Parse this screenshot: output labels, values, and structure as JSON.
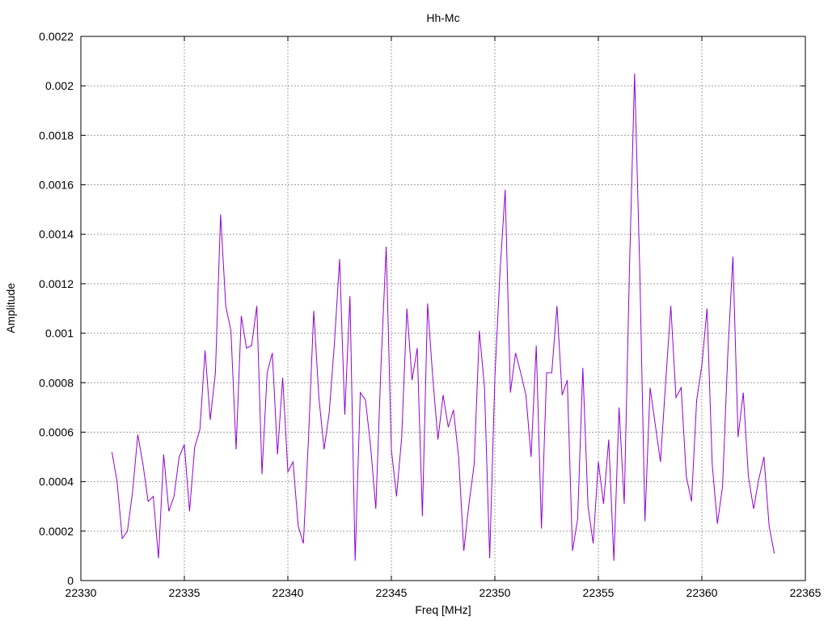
{
  "chart_data": {
    "type": "line",
    "title": "Hh-Mc",
    "xlabel": "Freq [MHz]",
    "ylabel": "Amplitude",
    "xlim": [
      22330,
      22365
    ],
    "ylim": [
      0,
      0.0022
    ],
    "grid": true,
    "x_ticks": [
      22330,
      22335,
      22340,
      22345,
      22350,
      22355,
      22360,
      22365
    ],
    "x_tick_labels": [
      "22330",
      "22335",
      "22340",
      "22345",
      "22350",
      "22355",
      "22360",
      "22365"
    ],
    "y_ticks": [
      0,
      0.0002,
      0.0004,
      0.0006,
      0.0008,
      0.001,
      0.0012,
      0.0014,
      0.0016,
      0.0018,
      0.002,
      0.0022
    ],
    "y_tick_labels": [
      "0",
      "0.0002",
      "0.0004",
      "0.0006",
      "0.0008",
      "0.001",
      "0.0012",
      "0.0014",
      "0.0016",
      "0.0018",
      "0.002",
      "0.0022"
    ],
    "series": [
      {
        "color": "#9400d3",
        "x": [
          22331.5,
          22331.75,
          22332,
          22332.25,
          22332.5,
          22332.75,
          22333,
          22333.25,
          22333.5,
          22333.75,
          22334,
          22334.25,
          22334.5,
          22334.75,
          22335,
          22335.25,
          22335.5,
          22335.75,
          22336,
          22336.25,
          22336.5,
          22336.75,
          22337,
          22337.25,
          22337.5,
          22337.75,
          22338,
          22338.25,
          22338.5,
          22338.75,
          22339,
          22339.25,
          22339.5,
          22339.75,
          22340,
          22340.25,
          22340.5,
          22340.75,
          22341,
          22341.25,
          22341.5,
          22341.75,
          22342,
          22342.25,
          22342.5,
          22342.75,
          22343,
          22343.25,
          22343.5,
          22343.75,
          22344,
          22344.25,
          22344.5,
          22344.75,
          22345,
          22345.25,
          22345.5,
          22345.75,
          22346,
          22346.25,
          22346.5,
          22346.75,
          22347,
          22347.25,
          22347.5,
          22347.75,
          22348,
          22348.25,
          22348.5,
          22348.75,
          22349,
          22349.25,
          22349.5,
          22349.75,
          22350,
          22350.25,
          22350.5,
          22350.75,
          22351,
          22351.25,
          22351.5,
          22351.75,
          22352,
          22352.25,
          22352.5,
          22352.75,
          22353,
          22353.25,
          22353.5,
          22353.75,
          22354,
          22354.25,
          22354.5,
          22354.75,
          22355,
          22355.25,
          22355.5,
          22355.75,
          22356,
          22356.25,
          22356.5,
          22356.75,
          22357,
          22357.25,
          22357.5,
          22357.75,
          22358,
          22358.25,
          22358.5,
          22358.75,
          22359,
          22359.25,
          22359.5,
          22359.75,
          22360,
          22360.25,
          22360.5,
          22360.75,
          22361,
          22361.25,
          22361.5,
          22361.75,
          22362,
          22362.25,
          22362.5,
          22362.75,
          22363,
          22363.25,
          22363.5
        ],
        "y": [
          0.00052,
          0.0004,
          0.00017,
          0.0002,
          0.00036,
          0.00059,
          0.00047,
          0.00032,
          0.00034,
          9e-05,
          0.00051,
          0.00028,
          0.00034,
          0.0005,
          0.00055,
          0.00028,
          0.00054,
          0.00061,
          0.00093,
          0.00065,
          0.00084,
          0.00148,
          0.00111,
          0.00101,
          0.00053,
          0.00107,
          0.00094,
          0.00095,
          0.00111,
          0.00043,
          0.00084,
          0.00092,
          0.00051,
          0.00082,
          0.00044,
          0.00048,
          0.00022,
          0.00015,
          0.00058,
          0.00109,
          0.00074,
          0.00053,
          0.00068,
          0.00096,
          0.0013,
          0.00067,
          0.00115,
          8e-05,
          0.00076,
          0.00073,
          0.00054,
          0.00029,
          0.00087,
          0.00135,
          0.00053,
          0.00034,
          0.00058,
          0.0011,
          0.00081,
          0.00094,
          0.00026,
          0.00112,
          0.00082,
          0.00057,
          0.00075,
          0.00062,
          0.00069,
          0.0005,
          0.00012,
          0.00031,
          0.00047,
          0.00101,
          0.00078,
          9e-05,
          0.00082,
          0.00125,
          0.00158,
          0.00076,
          0.00092,
          0.00084,
          0.00075,
          0.0005,
          0.00095,
          0.00021,
          0.00084,
          0.00084,
          0.00111,
          0.00075,
          0.00081,
          0.00012,
          0.00025,
          0.00086,
          0.0003,
          0.00015,
          0.00048,
          0.00031,
          0.00057,
          8e-05,
          0.0007,
          0.00031,
          0.00125,
          0.00205,
          0.00126,
          0.00024,
          0.00078,
          0.00063,
          0.00048,
          0.0008,
          0.00111,
          0.00074,
          0.00078,
          0.00042,
          0.00032,
          0.00073,
          0.00087,
          0.0011,
          0.00047,
          0.00023,
          0.00038,
          0.00091,
          0.00131,
          0.00058,
          0.00076,
          0.00042,
          0.00029,
          0.00041,
          0.0005,
          0.00022,
          0.00011
        ]
      }
    ]
  }
}
